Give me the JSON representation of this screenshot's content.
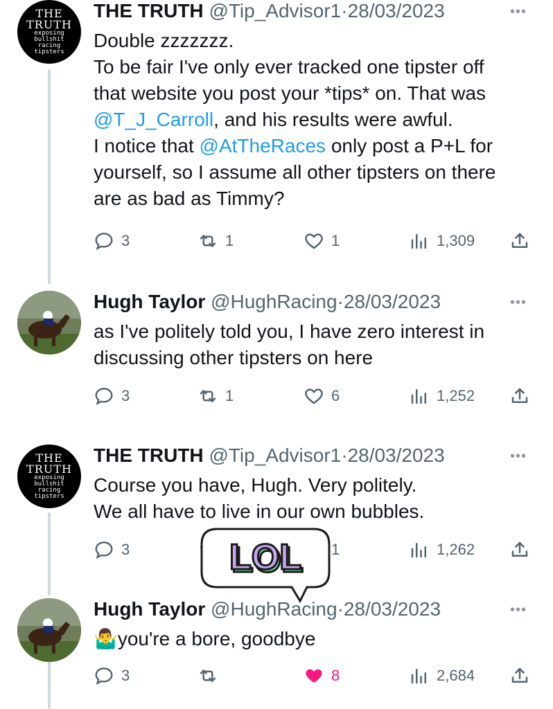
{
  "tweets": [
    {
      "name": "THE TRUTH",
      "handle": "@Tip_Advisor1",
      "date": "28/03/2023",
      "avatar": {
        "type": "truth",
        "big1": "THE",
        "big2": "TRUTH",
        "small": [
          "exposing",
          "bullshit",
          "racing",
          "tipsters"
        ]
      },
      "lines": [
        [
          {
            "t": "Double zzzzzzz."
          }
        ],
        [
          {
            "t": "To be fair I've only ever tracked one tipster off"
          }
        ],
        [
          {
            "t": "that website you post your *tips* on. That was"
          }
        ],
        [
          {
            "t": "@T_J_Carroll",
            "m": true
          },
          {
            "t": ", and his results were awful."
          }
        ],
        [
          {
            "t": "I notice that "
          },
          {
            "t": "@AtTheRaces",
            "m": true
          },
          {
            "t": " only post a P+L for"
          }
        ],
        [
          {
            "t": "yourself, so I assume all other tipsters on there"
          }
        ],
        [
          {
            "t": "are as bad as Timmy?"
          }
        ]
      ],
      "replies": "3",
      "retweets": "1",
      "likes": "1",
      "views": "1,309",
      "liked": false
    },
    {
      "name": "Hugh Taylor",
      "handle": "@HughRacing",
      "date": "28/03/2023",
      "avatar": {
        "type": "horse"
      },
      "lines": [
        [
          {
            "t": "as I've politely told you, I have zero interest in"
          }
        ],
        [
          {
            "t": "discussing other tipsters on here"
          }
        ]
      ],
      "replies": "3",
      "retweets": "1",
      "likes": "6",
      "views": "1,252",
      "liked": false
    },
    {
      "name": "THE TRUTH",
      "handle": "@Tip_Advisor1",
      "date": "28/03/2023",
      "avatar": {
        "type": "truth",
        "big1": "THE",
        "big2": "TRUTH",
        "small": [
          "exposing",
          "bullshit",
          "racing",
          "tipsters"
        ]
      },
      "lines": [
        [
          {
            "t": "Course you have, Hugh. Very politely."
          }
        ],
        [
          {
            "t": "We all have to live in our own bubbles."
          }
        ]
      ],
      "replies": "3",
      "retweets": "",
      "likes": "1",
      "views": "1,262",
      "liked": false
    },
    {
      "name": "Hugh Taylor",
      "handle": "@HughRacing",
      "date": "28/03/2023",
      "avatar": {
        "type": "horse"
      },
      "lines": [
        [
          {
            "t": "🤷‍♂️you're a bore, goodbye"
          }
        ]
      ],
      "replies": "3",
      "retweets": "",
      "likes": "8",
      "views": "2,684",
      "liked": true
    }
  ],
  "sticker": {
    "text": "LOL",
    "fill": "#c7a6f3",
    "outline": "#1a1a1a",
    "shadow": "#7de0a6"
  },
  "colors": {
    "mention": "#1d9bf0",
    "like": "#f91880",
    "meta": "#536471"
  }
}
